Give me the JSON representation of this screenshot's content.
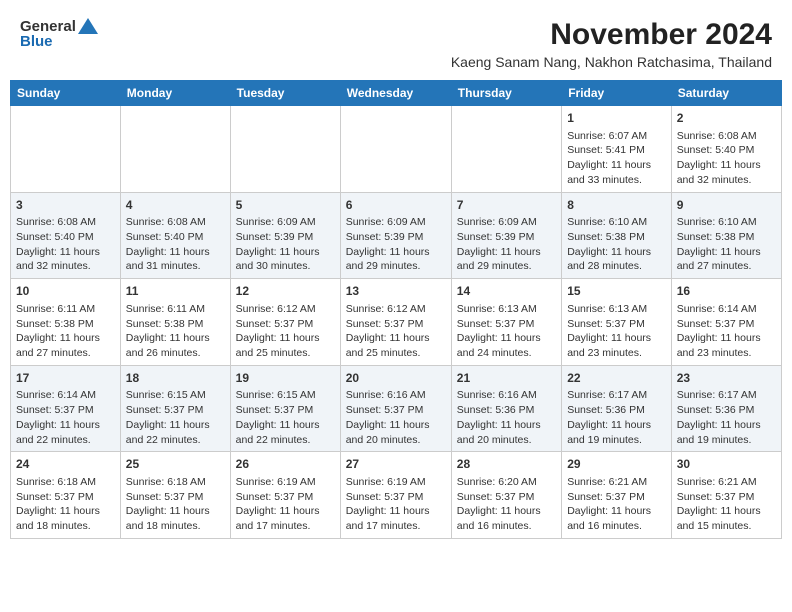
{
  "header": {
    "logo_general": "General",
    "logo_blue": "Blue",
    "month": "November 2024",
    "location": "Kaeng Sanam Nang, Nakhon Ratchasima, Thailand"
  },
  "weekdays": [
    "Sunday",
    "Monday",
    "Tuesday",
    "Wednesday",
    "Thursday",
    "Friday",
    "Saturday"
  ],
  "weeks": [
    [
      {
        "day": "",
        "info": ""
      },
      {
        "day": "",
        "info": ""
      },
      {
        "day": "",
        "info": ""
      },
      {
        "day": "",
        "info": ""
      },
      {
        "day": "",
        "info": ""
      },
      {
        "day": "1",
        "info": "Sunrise: 6:07 AM\nSunset: 5:41 PM\nDaylight: 11 hours\nand 33 minutes."
      },
      {
        "day": "2",
        "info": "Sunrise: 6:08 AM\nSunset: 5:40 PM\nDaylight: 11 hours\nand 32 minutes."
      }
    ],
    [
      {
        "day": "3",
        "info": "Sunrise: 6:08 AM\nSunset: 5:40 PM\nDaylight: 11 hours\nand 32 minutes."
      },
      {
        "day": "4",
        "info": "Sunrise: 6:08 AM\nSunset: 5:40 PM\nDaylight: 11 hours\nand 31 minutes."
      },
      {
        "day": "5",
        "info": "Sunrise: 6:09 AM\nSunset: 5:39 PM\nDaylight: 11 hours\nand 30 minutes."
      },
      {
        "day": "6",
        "info": "Sunrise: 6:09 AM\nSunset: 5:39 PM\nDaylight: 11 hours\nand 29 minutes."
      },
      {
        "day": "7",
        "info": "Sunrise: 6:09 AM\nSunset: 5:39 PM\nDaylight: 11 hours\nand 29 minutes."
      },
      {
        "day": "8",
        "info": "Sunrise: 6:10 AM\nSunset: 5:38 PM\nDaylight: 11 hours\nand 28 minutes."
      },
      {
        "day": "9",
        "info": "Sunrise: 6:10 AM\nSunset: 5:38 PM\nDaylight: 11 hours\nand 27 minutes."
      }
    ],
    [
      {
        "day": "10",
        "info": "Sunrise: 6:11 AM\nSunset: 5:38 PM\nDaylight: 11 hours\nand 27 minutes."
      },
      {
        "day": "11",
        "info": "Sunrise: 6:11 AM\nSunset: 5:38 PM\nDaylight: 11 hours\nand 26 minutes."
      },
      {
        "day": "12",
        "info": "Sunrise: 6:12 AM\nSunset: 5:37 PM\nDaylight: 11 hours\nand 25 minutes."
      },
      {
        "day": "13",
        "info": "Sunrise: 6:12 AM\nSunset: 5:37 PM\nDaylight: 11 hours\nand 25 minutes."
      },
      {
        "day": "14",
        "info": "Sunrise: 6:13 AM\nSunset: 5:37 PM\nDaylight: 11 hours\nand 24 minutes."
      },
      {
        "day": "15",
        "info": "Sunrise: 6:13 AM\nSunset: 5:37 PM\nDaylight: 11 hours\nand 23 minutes."
      },
      {
        "day": "16",
        "info": "Sunrise: 6:14 AM\nSunset: 5:37 PM\nDaylight: 11 hours\nand 23 minutes."
      }
    ],
    [
      {
        "day": "17",
        "info": "Sunrise: 6:14 AM\nSunset: 5:37 PM\nDaylight: 11 hours\nand 22 minutes."
      },
      {
        "day": "18",
        "info": "Sunrise: 6:15 AM\nSunset: 5:37 PM\nDaylight: 11 hours\nand 22 minutes."
      },
      {
        "day": "19",
        "info": "Sunrise: 6:15 AM\nSunset: 5:37 PM\nDaylight: 11 hours\nand 22 minutes."
      },
      {
        "day": "20",
        "info": "Sunrise: 6:16 AM\nSunset: 5:37 PM\nDaylight: 11 hours\nand 20 minutes."
      },
      {
        "day": "21",
        "info": "Sunrise: 6:16 AM\nSunset: 5:36 PM\nDaylight: 11 hours\nand 20 minutes."
      },
      {
        "day": "22",
        "info": "Sunrise: 6:17 AM\nSunset: 5:36 PM\nDaylight: 11 hours\nand 19 minutes."
      },
      {
        "day": "23",
        "info": "Sunrise: 6:17 AM\nSunset: 5:36 PM\nDaylight: 11 hours\nand 19 minutes."
      }
    ],
    [
      {
        "day": "24",
        "info": "Sunrise: 6:18 AM\nSunset: 5:37 PM\nDaylight: 11 hours\nand 18 minutes."
      },
      {
        "day": "25",
        "info": "Sunrise: 6:18 AM\nSunset: 5:37 PM\nDaylight: 11 hours\nand 18 minutes."
      },
      {
        "day": "26",
        "info": "Sunrise: 6:19 AM\nSunset: 5:37 PM\nDaylight: 11 hours\nand 17 minutes."
      },
      {
        "day": "27",
        "info": "Sunrise: 6:19 AM\nSunset: 5:37 PM\nDaylight: 11 hours\nand 17 minutes."
      },
      {
        "day": "28",
        "info": "Sunrise: 6:20 AM\nSunset: 5:37 PM\nDaylight: 11 hours\nand 16 minutes."
      },
      {
        "day": "29",
        "info": "Sunrise: 6:21 AM\nSunset: 5:37 PM\nDaylight: 11 hours\nand 16 minutes."
      },
      {
        "day": "30",
        "info": "Sunrise: 6:21 AM\nSunset: 5:37 PM\nDaylight: 11 hours\nand 15 minutes."
      }
    ]
  ]
}
